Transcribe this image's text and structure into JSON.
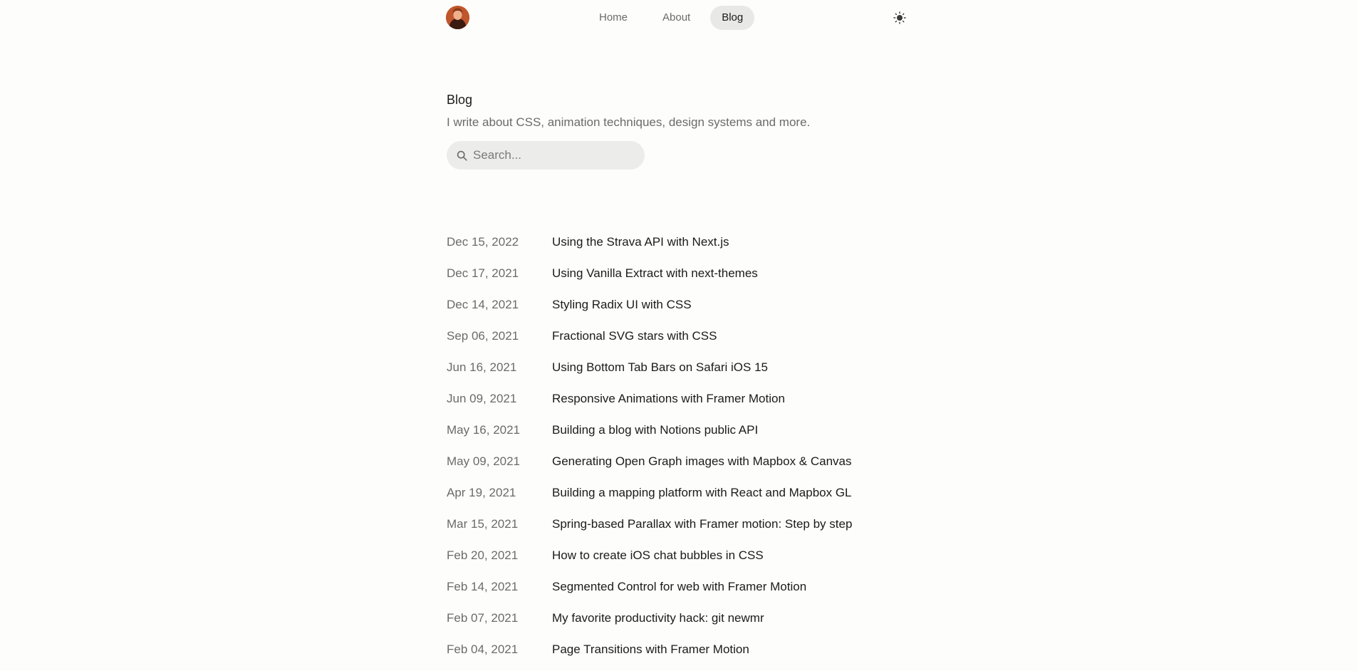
{
  "header": {
    "avatar_alt": "avatar",
    "nav": [
      {
        "label": "Home",
        "active": false
      },
      {
        "label": "About",
        "active": false
      },
      {
        "label": "Blog",
        "active": true
      }
    ],
    "theme_icon": "sun-icon"
  },
  "intro": {
    "title": "Blog",
    "subtitle": "I write about CSS, animation techniques, design systems and more."
  },
  "search": {
    "placeholder": "Search...",
    "value": "",
    "icon": "search-icon"
  },
  "posts": [
    {
      "date": "Dec 15, 2022",
      "title": "Using the Strava API with Next.js"
    },
    {
      "date": "Dec 17, 2021",
      "title": "Using Vanilla Extract with next-themes"
    },
    {
      "date": "Dec 14, 2021",
      "title": "Styling Radix UI with CSS"
    },
    {
      "date": "Sep 06, 2021",
      "title": "Fractional SVG stars with CSS"
    },
    {
      "date": "Jun 16, 2021",
      "title": "Using Bottom Tab Bars on Safari iOS 15"
    },
    {
      "date": "Jun 09, 2021",
      "title": "Responsive Animations with Framer Motion"
    },
    {
      "date": "May 16, 2021",
      "title": "Building a blog with Notions public API"
    },
    {
      "date": "May 09, 2021",
      "title": "Generating Open Graph images with Mapbox & Canvas"
    },
    {
      "date": "Apr 19, 2021",
      "title": "Building a mapping platform with React and Mapbox GL"
    },
    {
      "date": "Mar 15, 2021",
      "title": "Spring-based Parallax with Framer motion: Step by step"
    },
    {
      "date": "Feb 20, 2021",
      "title": "How to create iOS chat bubbles in CSS"
    },
    {
      "date": "Feb 14, 2021",
      "title": "Segmented Control for web with Framer Motion"
    },
    {
      "date": "Feb 07, 2021",
      "title": "My favorite productivity hack: git newmr"
    },
    {
      "date": "Feb 04, 2021",
      "title": "Page Transitions with Framer Motion"
    }
  ],
  "colors": {
    "background": "#fdfdfc",
    "text": "#1b1b18",
    "muted": "#6b6b67",
    "pill": "#e8e8e6"
  }
}
